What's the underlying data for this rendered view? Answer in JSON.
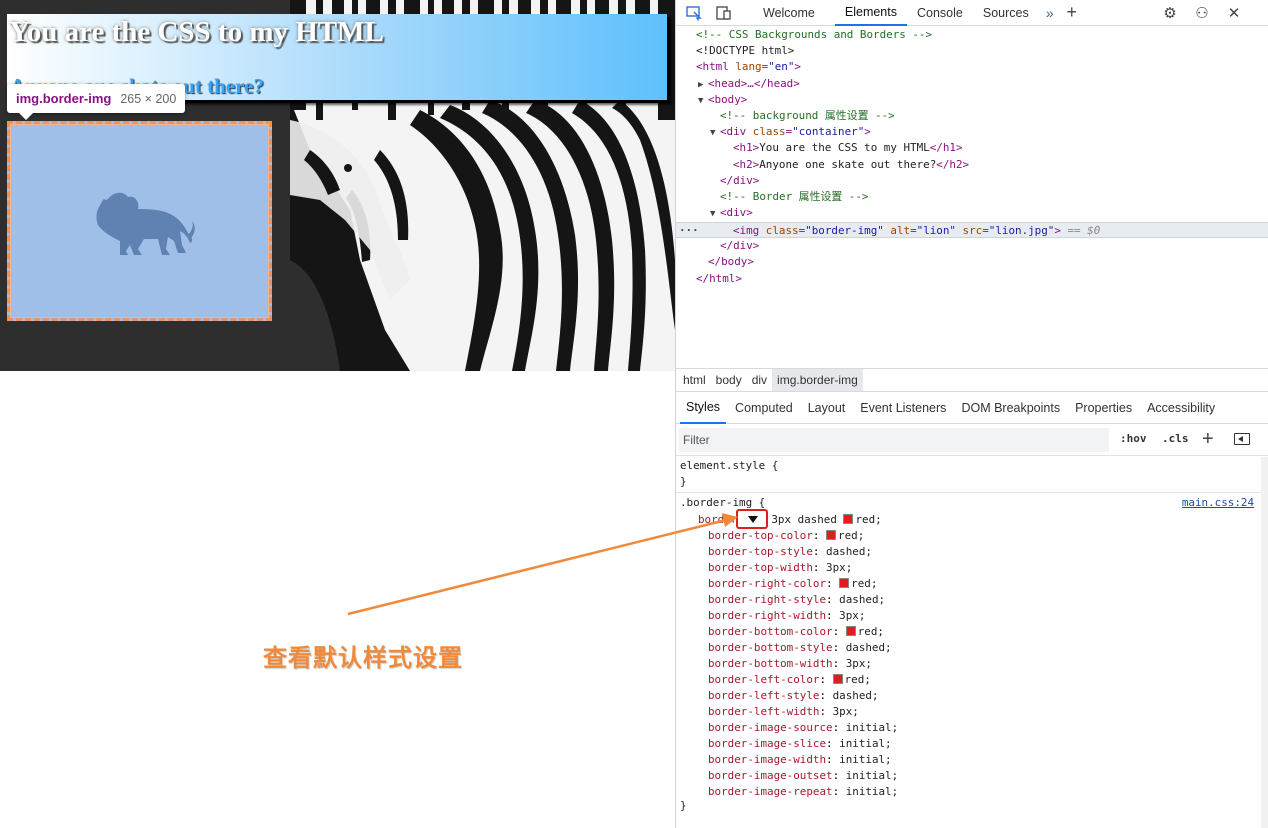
{
  "preview": {
    "h1": "You are the CSS to my HTML",
    "h2": "Anyone one skate out there?",
    "tooltip": {
      "selector": "img.border-img",
      "dimensions": "265 × 200"
    }
  },
  "devtools": {
    "tabs": [
      "Welcome",
      "Elements",
      "Console",
      "Sources"
    ],
    "active_tab": "Elements",
    "dom": {
      "comment1": "<!-- CSS Backgrounds and Borders -->",
      "doctype": "<!DOCTYPE html>",
      "html_open_tag": "<html",
      "html_lang_attr": "lang",
      "html_lang_val": "\"en\"",
      "head": "<head>…</head>",
      "body_open": "<body>",
      "comment2": "<!-- background 属性设置 -->",
      "div_container_tag": "<div",
      "div_container_attr": "class",
      "div_container_val": "\"container\"",
      "h1_open": "<h1>",
      "h1_text": "You are the CSS to my HTML",
      "h1_close": "</h1>",
      "h2_open": "<h2>",
      "h2_text": "Anyone one skate out there?",
      "h2_close": "</h2>",
      "div_close": "</div>",
      "comment3": "<!-- Border 属性设置 -->",
      "div_open": "<div>",
      "img_tag": "<img",
      "img_class_attr": "class",
      "img_class_val": "\"border-img\"",
      "img_alt_attr": "alt",
      "img_alt_val": "\"lion\"",
      "img_src_attr": "src",
      "img_src_val": "\"lion.jpg\"",
      "img_end": ">",
      "dollar": "== $0",
      "div_close2": "</div>",
      "body_close": "</body>",
      "html_close": "</html>",
      "dots": "···"
    },
    "breadcrumb": [
      "html",
      "body",
      "div",
      "img.border-img"
    ],
    "subtabs": [
      "Styles",
      "Computed",
      "Layout",
      "Event Listeners",
      "DOM Breakpoints",
      "Properties",
      "Accessibility"
    ],
    "active_subtab": "Styles",
    "filter": {
      "placeholder": "Filter",
      "hov": ":hov",
      "cls": ".cls"
    },
    "styles": {
      "element_style_open": "element.style {",
      "element_style_close": "}",
      "rule_selector": ".border-img {",
      "source": "main.css:24",
      "border_name": "border",
      "border_value": "3px dashed",
      "border_color": "red;",
      "longhands": [
        {
          "name": "border-top-color",
          "value": "red;",
          "swatch": true
        },
        {
          "name": "border-top-style",
          "value": "dashed;"
        },
        {
          "name": "border-top-width",
          "value": "3px;"
        },
        {
          "name": "border-right-color",
          "value": "red;",
          "swatch": true
        },
        {
          "name": "border-right-style",
          "value": "dashed;"
        },
        {
          "name": "border-right-width",
          "value": "3px;"
        },
        {
          "name": "border-bottom-color",
          "value": "red;",
          "swatch": true
        },
        {
          "name": "border-bottom-style",
          "value": "dashed;"
        },
        {
          "name": "border-bottom-width",
          "value": "3px;"
        },
        {
          "name": "border-left-color",
          "value": "red;",
          "swatch": true
        },
        {
          "name": "border-left-style",
          "value": "dashed;"
        },
        {
          "name": "border-left-width",
          "value": "3px;"
        },
        {
          "name": "border-image-source",
          "value": "initial;"
        },
        {
          "name": "border-image-slice",
          "value": "initial;"
        },
        {
          "name": "border-image-width",
          "value": "initial;"
        },
        {
          "name": "border-image-outset",
          "value": "initial;"
        },
        {
          "name": "border-image-repeat",
          "value": "initial;"
        }
      ],
      "rule_close": "}"
    }
  },
  "annotation": {
    "text": "查看默认样式设置"
  },
  "colors": {
    "accent": "#1a73e8",
    "annotation": "#f08a3a",
    "swatch_red": "#e01e1e",
    "img_bg": "#9fbfe8"
  }
}
